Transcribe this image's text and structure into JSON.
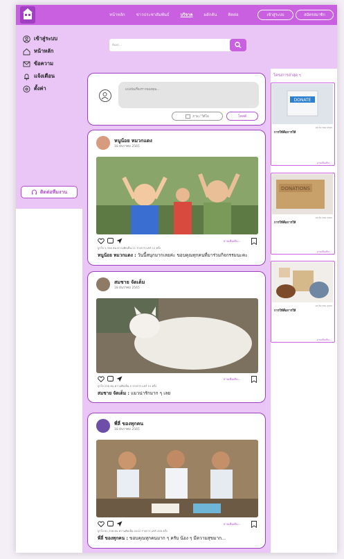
{
  "nav": {
    "links": [
      "หน้าหลัก",
      "ข่าวประชาสัมพันธ์",
      "บริจาค",
      "ผลักดัน",
      "ติดต่อ"
    ],
    "login_label": "เข้าสู่ระบบ",
    "register_label": "สมัครสมาชิก"
  },
  "search": {
    "placeholder": "ค้นหา..."
  },
  "sidebar": {
    "items": [
      {
        "label": "เข้าสู่ระบบ",
        "icon": "user-circle-icon"
      },
      {
        "label": "หน้าหลัก",
        "icon": "home-icon"
      },
      {
        "label": "ข้อความ",
        "icon": "mail-icon"
      },
      {
        "label": "แจ้งเตือน",
        "icon": "bell-icon"
      },
      {
        "label": "ตั้งค่า",
        "icon": "gear-icon"
      }
    ],
    "contact_label": "ติดต่อทีมงาน"
  },
  "composer": {
    "placeholder": "แบ่งปันเรื่องราวของคุณ...",
    "photo_label": "ภาพ / วิดีโอ",
    "post_label": "โพสต์"
  },
  "posts": [
    {
      "author": "หนูน้อย หมวกแดง",
      "date": "18 ธันวาคม 2565",
      "stats": "ถูกใจ 1,358 คน  ความคิดเห็น 21 รายการ แชร์ 12 ครั้ง",
      "caption_name": "หนูน้อย หมวกแดง :",
      "caption_text": " วันนี้สนุกมากเลยค่ะ ขอบคุณทุกคนที่มาร่วมกิจกรรมนะคะ",
      "read_more": "อ่านเพิ่มเติม..."
    },
    {
      "author": "สมชาย จัดเต็ม",
      "date": "18 ธันวาคม 2565",
      "stats": "ถูกใจ 258 คน  ความคิดเห็น 5 รายการ แชร์ 10 ครั้ง",
      "caption_name": "สมชาย จัดเต็ม :",
      "caption_text": " แมวน่ารักมาก ๆ เลย",
      "read_more": "อ่านเพิ่มเติม..."
    },
    {
      "author": "พี่ลี่ ของทุกคน",
      "date": "18 ธันวาคม 2565",
      "stats": "ถูกใจ 61,358 คน  ความคิดเห็น 2002 รายการ แชร์ 458 ครั้ง",
      "caption_name": "พี่ลี่ ของทุกคน :",
      "caption_text": " ขอบคุณทุกคนมาก ๆ ครับ น้อง ๆ มีความสุขมาก...",
      "read_more": "อ่านเพิ่มเติม..."
    }
  ],
  "right": {
    "title": "โครงการล่าสุด ๆ",
    "cards": [
      {
        "title": "การให้คือการให้",
        "date": "18 ธันวาคม 2565",
        "read_more": "อ่านเพิ่มเติม...",
        "box_text": "DONATE"
      },
      {
        "title": "การให้คือการให้",
        "date": "18 ธันวาคม 2565",
        "read_more": "อ่านเพิ่มเติม...",
        "box_text": "DONATIONS"
      },
      {
        "title": "การให้คือการให้",
        "date": "18 ธันวาคม 2565",
        "read_more": "อ่านเพิ่มเติม...",
        "box_text": ""
      }
    ]
  },
  "colors": {
    "accent": "#c860e0",
    "light_lavender": "#e9c6f5",
    "border_purple": "#9b3fc0"
  }
}
